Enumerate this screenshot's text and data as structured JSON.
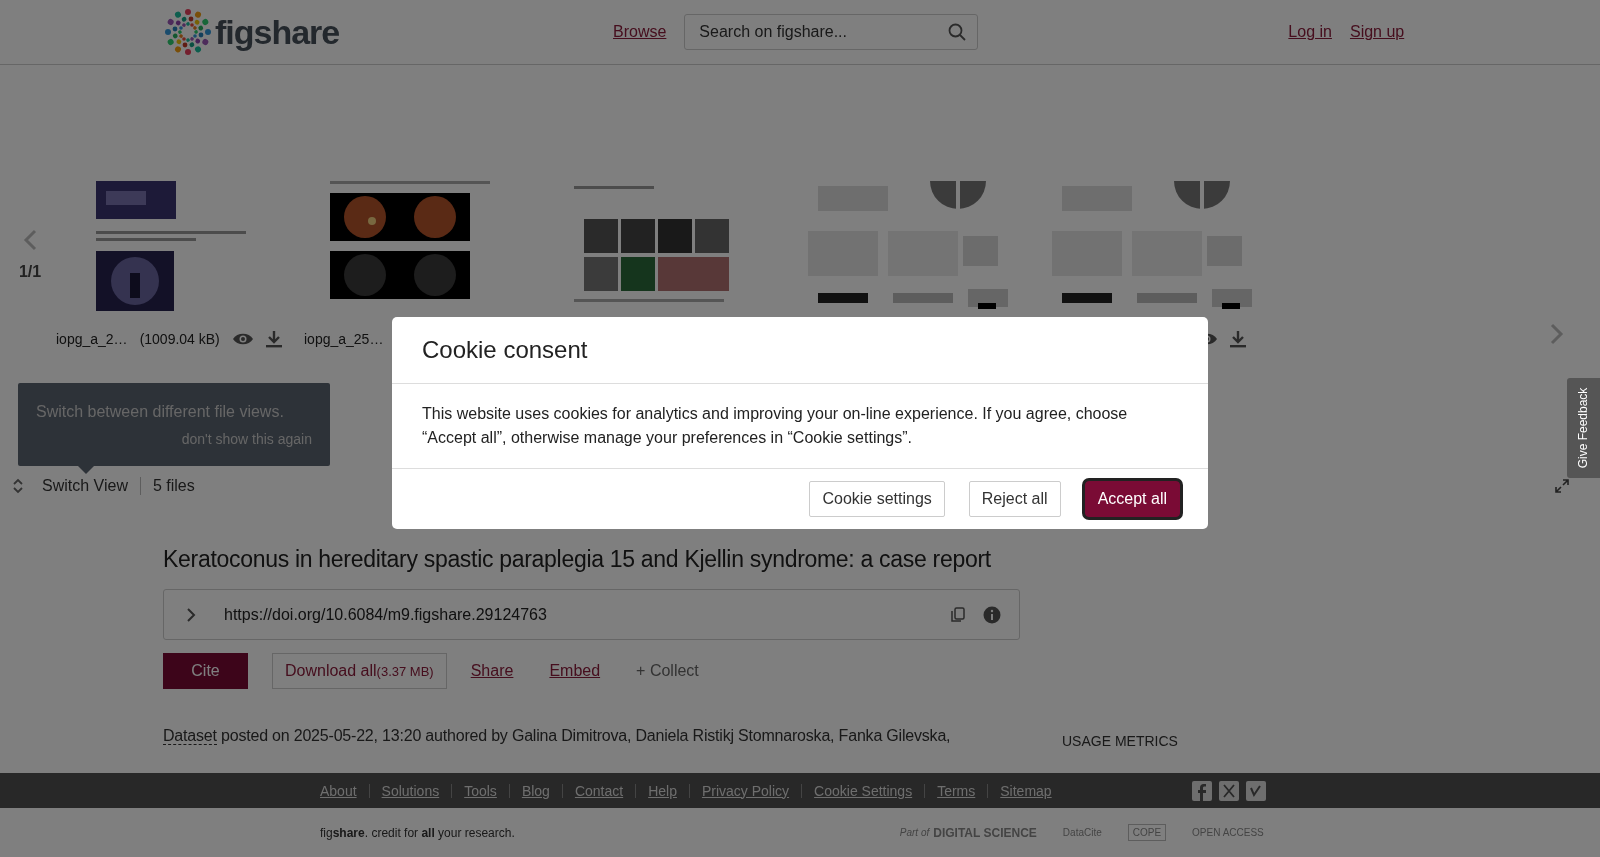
{
  "header": {
    "logo": "figshare",
    "nav_link": "Browse",
    "search": {
      "placeholder": "Search on figshare..."
    },
    "account_links": [
      "Log in",
      "Sign up"
    ]
  },
  "carousel": {
    "page": "1/1",
    "files": [
      {
        "kind": "picture",
        "name": "iopg_a_2…",
        "size": "(1009.04 kB)",
        "controls": true
      },
      {
        "kind": "picture",
        "name": "iopg_a_25…"
      },
      {
        "kind": "picture"
      },
      {
        "kind": "picture"
      },
      {
        "kind": "picture",
        "controls": true
      }
    ]
  },
  "tooltip": {
    "text": "Switch between different file views.",
    "dismiss": "don't show this again"
  },
  "view_bar": {
    "switch_label": "Switch View",
    "file_count": "5 files"
  },
  "item": {
    "title": "Keratoconus in hereditary spastic paraplegia 15 and Kjellin syndrome: a case report",
    "doi": "https://doi.org/10.6084/m9.figshare.29124763",
    "actions": [
      {
        "label": "Cite",
        "kind": "primary"
      },
      {
        "label": "Download all",
        "note": "(3.37 MB)",
        "kind": "outline"
      },
      {
        "label": "Share",
        "kind": "link"
      },
      {
        "label": "Embed",
        "kind": "link"
      },
      {
        "label": "+ Collect",
        "kind": "muted"
      }
    ],
    "meta": {
      "type_link": "Dataset",
      "text": "posted on 2025-05-22, 13:20 authored by Galina Dimitrova, Daniela Ristikj Stomnaroska, Fanka Gilevska,"
    },
    "usage_heading": "USAGE METRICS"
  },
  "feedback_tab": "Give Feedback",
  "footer": {
    "links": [
      "About",
      "Solutions",
      "Tools",
      "Blog",
      "Contact",
      "Help",
      "Privacy Policy",
      "Cookie Settings",
      "Terms",
      "Sitemap"
    ],
    "tagline": "fig**share**. credit for **all** your research.",
    "partners": [
      "Part of",
      "DIGITAL SCIENCE",
      "DataCite",
      "COPE",
      "OPEN ACCESS"
    ]
  },
  "cookie": {
    "title": "Cookie consent",
    "body": "This website uses cookies for analytics and improving your on-line experience. If you agree, choose “Accept all”, otherwise manage your preferences in “Cookie settings”.",
    "buttons": [
      {
        "label": "Cookie settings",
        "kind": "secondary",
        "focused": false
      },
      {
        "label": "Reject all",
        "kind": "secondary",
        "focused": false
      },
      {
        "label": "Accept all",
        "kind": "primary",
        "focused": true
      }
    ]
  }
}
